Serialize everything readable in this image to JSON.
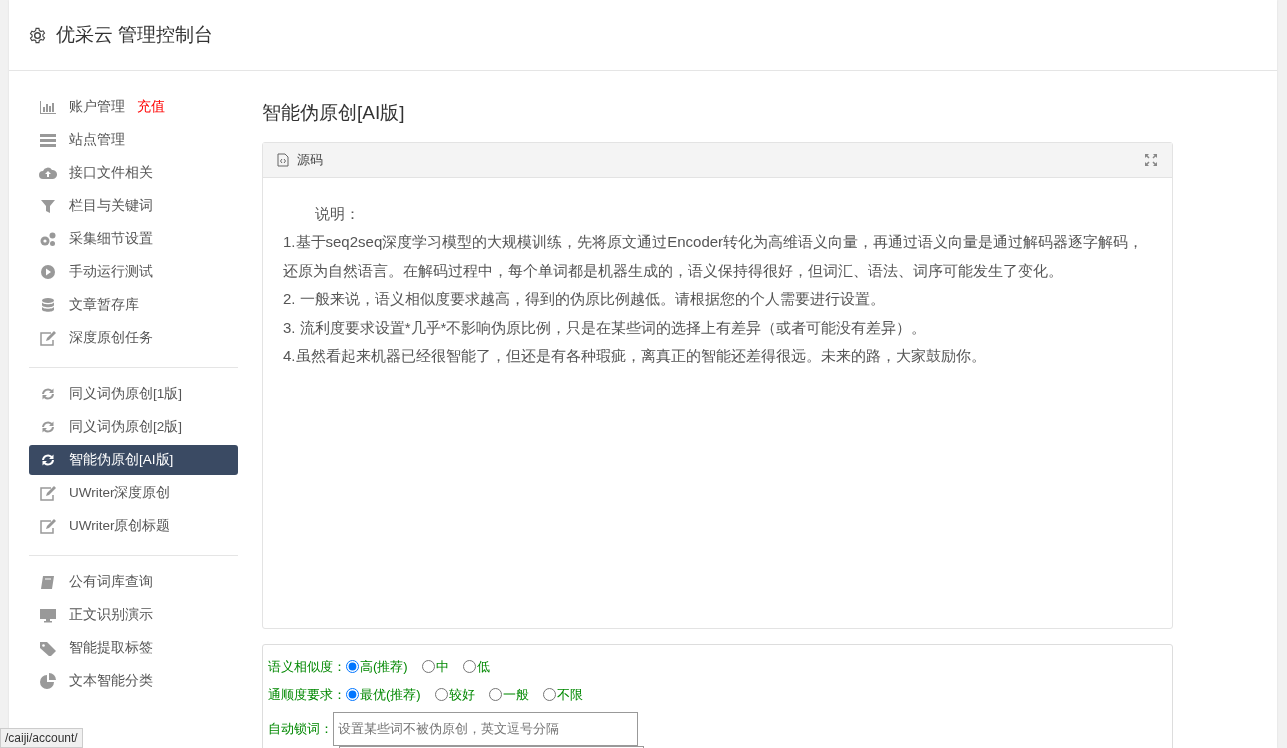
{
  "header": {
    "title": "优采云 管理控制台"
  },
  "sidebar": {
    "groups": [
      {
        "items": [
          {
            "label": "账户管理",
            "extra": "充值",
            "selected": false
          },
          {
            "label": "站点管理",
            "selected": false
          },
          {
            "label": "接口文件相关",
            "selected": false
          },
          {
            "label": "栏目与关键词",
            "selected": false
          },
          {
            "label": "采集细节设置",
            "selected": false
          },
          {
            "label": "手动运行测试",
            "selected": false
          },
          {
            "label": "文章暂存库",
            "selected": false
          },
          {
            "label": "深度原创任务",
            "selected": false
          }
        ]
      },
      {
        "items": [
          {
            "label": "同义词伪原创[1版]",
            "selected": false
          },
          {
            "label": "同义词伪原创[2版]",
            "selected": false
          },
          {
            "label": "智能伪原创[AI版]",
            "selected": true
          },
          {
            "label": "UWriter深度原创",
            "selected": false
          },
          {
            "label": "UWriter原创标题",
            "selected": false
          }
        ]
      },
      {
        "items": [
          {
            "label": "公有词库查询",
            "selected": false
          },
          {
            "label": "正文识别演示",
            "selected": false
          },
          {
            "label": "智能提取标签",
            "selected": false
          },
          {
            "label": "文本智能分类",
            "selected": false
          }
        ]
      }
    ]
  },
  "page_title": "智能伪原创[AI版]",
  "editor": {
    "tab": "源码",
    "lines": [
      "说明：",
      "1.基于seq2seq深度学习模型的大规模训练，先将原文通过Encoder转化为高维语义向量，再通过语义向量是通过解码器逐字解码，还原为自然语言。在解码过程中，每个单词都是机器生成的，语义保持得很好，但词汇、语法、词序可能发生了变化。",
      "2. 一般来说，语义相似度要求越高，得到的伪原比例越低。请根据您的个人需要进行设置。",
      "3. 流利度要求设置*几乎*不影响伪原比例，只是在某些词的选择上有差异（或者可能没有差异）。",
      "4.虽然看起来机器已经很智能了，但还是有各种瑕疵，离真正的智能还差得很远。未来的路，大家鼓励你。"
    ]
  },
  "options": [
    {
      "label": "语义相似度：",
      "choices": [
        {
          "label": "高(推荐)",
          "selected": true
        },
        {
          "label": "中",
          "selected": false
        },
        {
          "label": "低",
          "selected": false
        }
      ]
    },
    {
      "label": "通顺度要求：",
      "choices": [
        {
          "label": "最优(推荐)",
          "selected": true
        },
        {
          "label": "较好",
          "selected": false
        },
        {
          "label": "一般",
          "selected": false
        },
        {
          "label": "不限",
          "selected": false
        }
      ]
    }
  ],
  "lock_words": {
    "label": "自动锁词：",
    "placeholder": "设置某些词不被伪原创，英文逗号分隔"
  },
  "status_bar": {
    "url": "/caiji/account/"
  }
}
